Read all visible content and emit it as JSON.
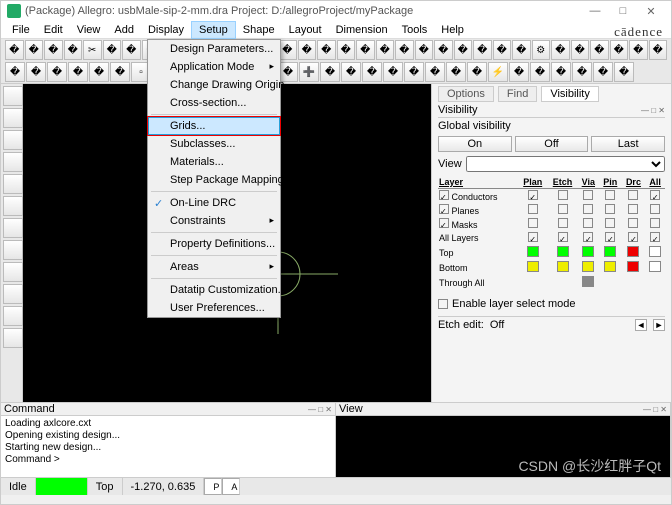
{
  "title": "(Package) Allegro: usbMale-sip-2-mm.dra  Project: D:/allegroProject/myPackage",
  "menus": [
    "File",
    "Edit",
    "View",
    "Add",
    "Display",
    "Setup",
    "Shape",
    "Layout",
    "Dimension",
    "Tools",
    "Help"
  ],
  "active_menu_index": 5,
  "brand": "cādence",
  "dropdown": {
    "groups": [
      [
        "Design Parameters...",
        "Application Mode",
        "Change Drawing Origin",
        "Cross-section..."
      ],
      [
        "Grids...",
        "Subclasses...",
        "Materials...",
        "Step Package Mapping..."
      ],
      [
        "On-Line DRC",
        "Constraints"
      ],
      [
        "Property Definitions..."
      ],
      [
        "Areas"
      ],
      [
        "Datatip Customization...",
        "User Preferences..."
      ]
    ],
    "highlighted": "Grids...",
    "checked": "On-Line DRC",
    "arrows": [
      "Application Mode",
      "Constraints",
      "Areas"
    ]
  },
  "right": {
    "tabs": [
      "Options",
      "Find",
      "Visibility"
    ],
    "active_tab": 2,
    "caption": "Visibility",
    "global_label": "Global visibility",
    "buttons": [
      "On",
      "Off",
      "Last"
    ],
    "view_label": "View",
    "headers": [
      "Layer",
      "Plan",
      "Etch",
      "Via",
      "Pin",
      "Drc",
      "All"
    ],
    "rows": [
      {
        "name": "Conductors",
        "checks": [
          "chk",
          "",
          "",
          "",
          "",
          "chk"
        ],
        "chkfront": true
      },
      {
        "name": "Planes",
        "checks": [
          "",
          "",
          "",
          "",
          "",
          ""
        ],
        "chkfront": true
      },
      {
        "name": "Masks",
        "checks": [
          "",
          "",
          "",
          "",
          "",
          ""
        ],
        "chkfront": true
      },
      {
        "name": "All Layers",
        "checks": [
          "chk",
          "chk",
          "chk",
          "chk",
          "chk",
          "chk"
        ],
        "chkfront": false
      }
    ],
    "crows": [
      {
        "name": "Top",
        "colors": [
          "#0f0",
          "#0f0",
          "#0f0",
          "#0f0",
          "#e00",
          "#fff"
        ],
        "chk": true
      },
      {
        "name": "Bottom",
        "colors": [
          "#ee0",
          "#ee0",
          "#ee0",
          "#ee0",
          "#e00",
          "#fff"
        ],
        "chk": true
      },
      {
        "name": "Through All",
        "colors": [
          "",
          "",
          "#888",
          "",
          "",
          ""
        ],
        "chk": true
      }
    ],
    "enable_label": "Enable layer select mode",
    "etch_label": "Etch edit:",
    "etch_val": "Off"
  },
  "command": {
    "title": "Command",
    "lines": [
      "Loading axlcore.cxt",
      "Opening existing design...",
      "Starting new design...",
      "Command >"
    ]
  },
  "view_panel": "View",
  "status": {
    "idle": "Idle",
    "layer": "Top",
    "coords": "-1.270, 0.635",
    "p": "P",
    "a": "A"
  },
  "watermark": "CSDN @长沙红胖子Qt"
}
